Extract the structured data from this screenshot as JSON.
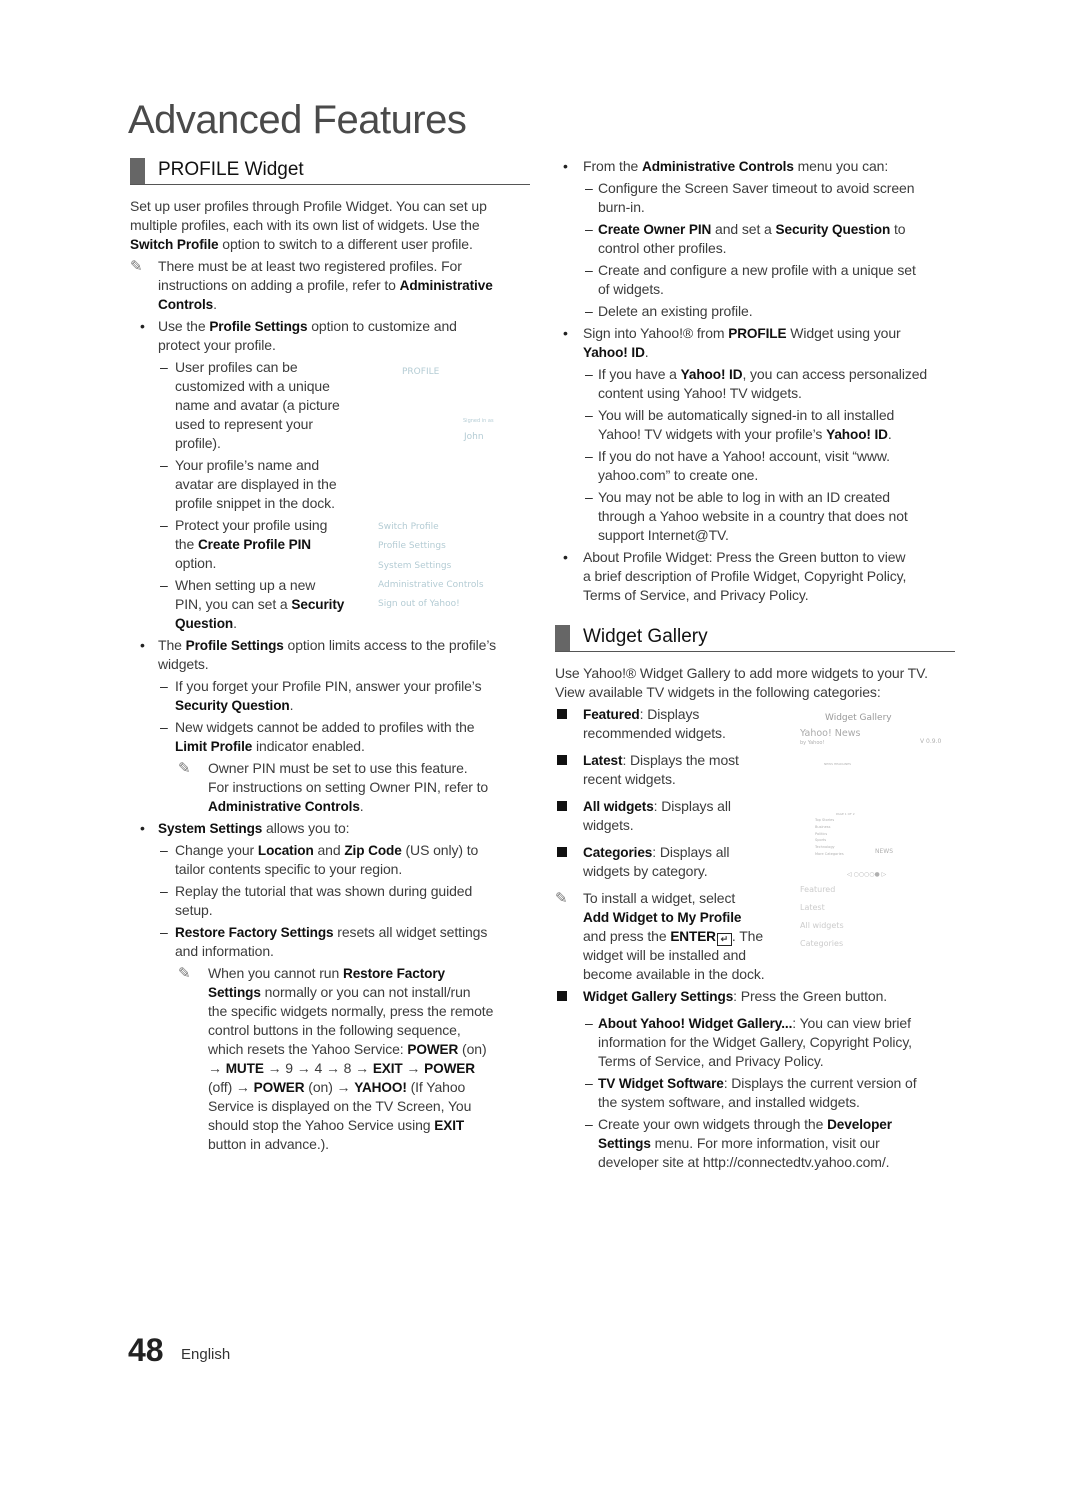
{
  "page_title": "Advanced Features",
  "footer": {
    "page_number": "48",
    "language": "English"
  },
  "left_column": {
    "section_title": "PROFILE Widget",
    "blocks": [
      {
        "type": "para",
        "lines": [
          [
            "Set up user profiles through Profile Widget. You can set up"
          ],
          [
            "multiple profiles, each with its own list of widgets. Use the"
          ],
          [
            {
              "b": "Switch Profile"
            },
            " option to switch to a different user profile."
          ]
        ]
      },
      {
        "type": "note1",
        "lines": [
          [
            "There must be at least two registered profiles. For"
          ],
          [
            "instructions on adding a profile, refer to ",
            {
              "b": "Administrative"
            }
          ],
          [
            {
              "b": "Controls"
            },
            "."
          ]
        ]
      },
      {
        "type": "bullet",
        "lines": [
          [
            "Use the ",
            {
              "b": "Profile Settings"
            },
            " option to customize and"
          ],
          [
            "protect your profile."
          ]
        ]
      },
      {
        "type": "dash",
        "lines": [
          [
            "User profiles can be"
          ],
          [
            "customized with a unique"
          ],
          [
            "name and avatar (a picture"
          ],
          [
            "used to represent your"
          ],
          [
            "profile)."
          ]
        ]
      },
      {
        "type": "dash",
        "lines": [
          [
            "Your profile’s name and"
          ],
          [
            "avatar are displayed in the"
          ],
          [
            "profile snippet in the dock."
          ]
        ]
      },
      {
        "type": "dash",
        "lines": [
          [
            "Protect your profile using"
          ],
          [
            "the ",
            {
              "b": "Create Profile PIN"
            }
          ],
          [
            "option."
          ]
        ]
      },
      {
        "type": "dash",
        "lines": [
          [
            "When setting up a new"
          ],
          [
            "PIN, you can set a ",
            {
              "b": "Security"
            }
          ],
          [
            {
              "b": "Question"
            },
            "."
          ]
        ]
      },
      {
        "type": "bullet",
        "lines": [
          [
            "The ",
            {
              "b": "Profile Settings"
            },
            " option limits access to the profile’s"
          ],
          [
            "widgets."
          ]
        ]
      },
      {
        "type": "dash",
        "lines": [
          [
            "If you forget your Profile PIN, answer your profile’s"
          ],
          [
            {
              "b": "Security Question"
            },
            "."
          ]
        ]
      },
      {
        "type": "dash",
        "lines": [
          [
            "New widgets cannot be added to profiles with the"
          ],
          [
            {
              "b": "Limit Profile"
            },
            " indicator enabled."
          ]
        ]
      },
      {
        "type": "note2",
        "lines": [
          [
            "Owner PIN must be set to use this feature."
          ],
          [
            "For instructions on setting Owner PIN, refer to"
          ],
          [
            {
              "b": "Administrative Controls"
            },
            "."
          ]
        ]
      },
      {
        "type": "bullet",
        "lines": [
          [
            {
              "b": "System Settings"
            },
            " allows you to:"
          ]
        ]
      },
      {
        "type": "dash",
        "lines": [
          [
            "Change your ",
            {
              "b": "Location"
            },
            " and ",
            {
              "b": "Zip Code"
            },
            " (US only) to"
          ],
          [
            "tailor contents specific to your region."
          ]
        ]
      },
      {
        "type": "dash",
        "lines": [
          [
            "Replay the tutorial that was shown during guided"
          ],
          [
            "setup."
          ]
        ]
      },
      {
        "type": "dash",
        "lines": [
          [
            {
              "b": "Restore Factory Settings"
            },
            " resets all widget settings"
          ],
          [
            "and information."
          ]
        ]
      },
      {
        "type": "note2",
        "lines": [
          [
            "When you cannot run ",
            {
              "b": "Restore Factory"
            }
          ],
          [
            {
              "b": "Settings"
            },
            " normally or you can not install/run"
          ],
          [
            "the specific widgets normally, press the remote"
          ],
          [
            "control buttons in the following sequence,"
          ],
          [
            "which resets the Yahoo Service: ",
            {
              "b": "POWER"
            },
            " (on)"
          ],
          [
            "→ ",
            {
              "b": "MUTE"
            },
            " → 9 → 4 → 8 → ",
            {
              "b": "EXIT"
            },
            " → ",
            {
              "b": "POWER"
            }
          ],
          [
            "(off) → ",
            {
              "b": "POWER"
            },
            " (on) → ",
            {
              "b": "YAHOO!"
            },
            " (If Yahoo"
          ],
          [
            "Service is displayed on the TV Screen, You"
          ],
          [
            "should stop the Yahoo Service using ",
            {
              "b": "EXIT"
            }
          ],
          [
            "button in advance.)."
          ]
        ]
      }
    ]
  },
  "right_column": {
    "blocks_top": [
      {
        "type": "bullet",
        "lines": [
          [
            "From the ",
            {
              "b": "Administrative Controls"
            },
            " menu you can:"
          ]
        ]
      },
      {
        "type": "dash",
        "lines": [
          [
            "Configure the Screen Saver timeout to avoid screen"
          ],
          [
            "burn-in."
          ]
        ]
      },
      {
        "type": "dash",
        "lines": [
          [
            {
              "b": "Create Owner PIN"
            },
            " and set a ",
            {
              "b": "Security Question"
            },
            " to"
          ],
          [
            "control other profiles."
          ]
        ]
      },
      {
        "type": "dash",
        "lines": [
          [
            "Create and configure a new profile with a unique set"
          ],
          [
            "of widgets."
          ]
        ]
      },
      {
        "type": "dash",
        "lines": [
          [
            "Delete an existing profile."
          ]
        ]
      },
      {
        "type": "bullet",
        "lines": [
          [
            "Sign into Yahoo!® from ",
            {
              "b": "PROFILE"
            },
            " Widget using your"
          ],
          [
            {
              "b": "Yahoo! ID"
            },
            "."
          ]
        ]
      },
      {
        "type": "dash",
        "lines": [
          [
            "If you have a ",
            {
              "b": "Yahoo! ID"
            },
            ", you can access personalized"
          ],
          [
            "content using Yahoo! TV widgets."
          ]
        ]
      },
      {
        "type": "dash",
        "lines": [
          [
            "You will be automatically signed-in to all installed"
          ],
          [
            "Yahoo! TV widgets with your profile’s ",
            {
              "b": "Yahoo! ID"
            },
            "."
          ]
        ]
      },
      {
        "type": "dash",
        "lines": [
          [
            "If you do not have a Yahoo! account, visit “www."
          ],
          [
            "yahoo.com” to create one."
          ]
        ]
      },
      {
        "type": "dash",
        "lines": [
          [
            "You may not be able to log in with an ID created"
          ],
          [
            "through a Yahoo website in a country that does not"
          ],
          [
            "support Internet@TV."
          ]
        ]
      },
      {
        "type": "bullet",
        "lines": [
          [
            "About Profile Widget: Press the Green button to view"
          ],
          [
            "a brief description of Profile Widget, Copyright Policy,"
          ],
          [
            "Terms of Service, and Privacy Policy."
          ]
        ]
      }
    ],
    "section_title": "Widget Gallery",
    "blocks_bottom": [
      {
        "type": "para",
        "lines": [
          [
            "Use Yahoo!® Widget Gallery to add more widgets to your TV."
          ],
          [
            "View available TV widgets in the following categories:"
          ]
        ]
      },
      {
        "type": "square",
        "lines": [
          [
            {
              "b": "Featured"
            },
            ": Displays"
          ],
          [
            "recommended widgets."
          ]
        ]
      },
      {
        "type": "square",
        "lines": [
          [
            {
              "b": "Latest"
            },
            ": Displays the most"
          ],
          [
            "recent widgets."
          ]
        ]
      },
      {
        "type": "square",
        "lines": [
          [
            {
              "b": "All widgets"
            },
            ": Displays all"
          ],
          [
            "widgets."
          ]
        ]
      },
      {
        "type": "square",
        "lines": [
          [
            {
              "b": "Categories"
            },
            ": Displays all"
          ],
          [
            "widgets by category."
          ]
        ]
      },
      {
        "type": "note1",
        "lines": [
          [
            "To install a widget, select"
          ],
          [
            {
              "b": "Add Widget to My Profile"
            }
          ],
          [
            "and press the ",
            {
              "b": "ENTER"
            },
            {
              "icon": "enter-icon"
            },
            ". The"
          ],
          [
            "widget will be installed and"
          ],
          [
            "become available in the dock."
          ]
        ]
      },
      {
        "type": "square",
        "lines": [
          [
            {
              "b": "Widget Gallery Settings"
            },
            ": Press the Green button."
          ]
        ]
      },
      {
        "type": "dash",
        "lines": [
          [
            {
              "b": "About Yahoo! Widget Gallery..."
            },
            ": You can view brief"
          ],
          [
            "information for the Widget Gallery, Copyright Policy,"
          ],
          [
            "Terms of Service, and Privacy Policy."
          ]
        ]
      },
      {
        "type": "dash",
        "lines": [
          [
            {
              "b": "TV Widget Software"
            },
            ": Displays the current version of"
          ],
          [
            "the system software, and installed widgets."
          ]
        ]
      },
      {
        "type": "dash",
        "lines": [
          [
            "Create your own widgets through the ",
            {
              "b": "Developer"
            }
          ],
          [
            {
              "b": "Settings"
            },
            " menu. For more information, visit our"
          ],
          [
            "developer site at http://connectedtv.yahoo.com/."
          ]
        ]
      }
    ]
  },
  "profile_screen": {
    "title": "PROFILE",
    "signed_in_label": "Signed in as",
    "user_name": "John",
    "menu": [
      "Switch Profile",
      "Profile Settings",
      "System Settings",
      "Administrative Controls",
      "Sign out of Yahoo!"
    ],
    "accent_color": "#b4ccd4"
  },
  "widget_gallery_screen": {
    "title": "Widget Gallery",
    "widget_name": "Yahoo! News",
    "widget_author": "by Yahoo!",
    "version": "V 0.9.0",
    "headlines_label": "NEWS HEADLINES",
    "page_label": "PAGE 1 OF 2",
    "news_categories": [
      "Top Stories",
      "Business",
      "Politics",
      "Sports",
      "Technology",
      "More Categories"
    ],
    "news_logo": "NEWS",
    "pager": "◁  ○○○○●  ▷",
    "menu": [
      "Featured",
      "Latest",
      "All widgets",
      "Categories"
    ]
  }
}
